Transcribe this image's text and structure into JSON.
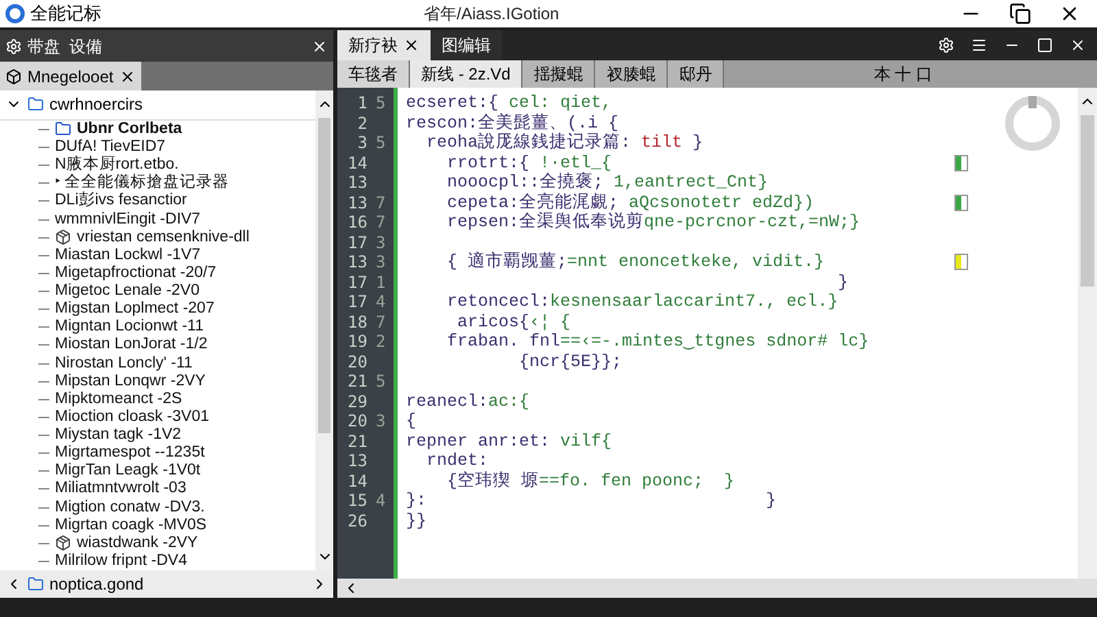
{
  "window": {
    "app_title": "全能记标",
    "title": "省年/Aiass.IGotion"
  },
  "left_panel": {
    "header": "带盘  设備",
    "tab": "Mnegelooet",
    "tree": {
      "label": "cwrhnoercirs",
      "expanded": true,
      "children": [
        {
          "label": "Ubnr Corlbeta",
          "kind": "folder"
        },
        {
          "label": "DUfA! TievEID7",
          "kind": "item"
        },
        {
          "label": "N腋本厨rort.etbo.",
          "kind": "item"
        },
        {
          "label": "‣ 全全能儀标搶盘记录器",
          "kind": "item"
        },
        {
          "label": "DLi彭ivs fesanctior",
          "kind": "item"
        },
        {
          "label": "wmmnivlEingit -DIV7",
          "kind": "item"
        },
        {
          "label": "vriestan cemsenknive-dll",
          "kind": "package"
        },
        {
          "label": "Miastan Lockwl -1V7",
          "kind": "item"
        },
        {
          "label": "Migetapfroctionat -20/7",
          "kind": "item"
        },
        {
          "label": "Migetoc Lenale -2V0",
          "kind": "item"
        },
        {
          "label": "Migstan Loplmect -207",
          "kind": "item"
        },
        {
          "label": "Migntan Locionwt -11",
          "kind": "item"
        },
        {
          "label": "Miostan LonJorat -1/2",
          "kind": "item"
        },
        {
          "label": "Nirostan Loncly' -11",
          "kind": "item"
        },
        {
          "label": "Mipstan Lonqwr -2VY",
          "kind": "item"
        },
        {
          "label": "Mipktomeanct -2S",
          "kind": "item"
        },
        {
          "label": "Mioction cloask -3V01",
          "kind": "item"
        },
        {
          "label": "Miystan tagk -1V2",
          "kind": "item"
        },
        {
          "label": "Migrtamespot --1235t",
          "kind": "item"
        },
        {
          "label": "MigrTan Leagk -1V0t",
          "kind": "item"
        },
        {
          "label": "Miliatmntvwrolt -03",
          "kind": "item"
        },
        {
          "label": "Migtion conatw -DV3.",
          "kind": "item"
        },
        {
          "label": "Migrtan coagk -MV0S",
          "kind": "item"
        },
        {
          "label": "wiastdwank -2VY",
          "kind": "package"
        },
        {
          "label": "Milrilow fripnt -DV4",
          "kind": "item"
        }
      ]
    },
    "footer": "noptica.gond"
  },
  "editor": {
    "tabs": [
      {
        "label": "新疗袂",
        "selected": true
      },
      {
        "label": "图编辑",
        "selected": false
      }
    ],
    "subtabs": [
      {
        "label": "车毯者",
        "selected": false
      },
      {
        "label": "新线 - 2z.Vd",
        "selected": true
      },
      {
        "label": "揺擬蜫",
        "selected": false
      },
      {
        "label": "衩腠蜫",
        "selected": false
      },
      {
        "label": "邸丹",
        "selected": false
      }
    ],
    "toolbar_text": "本 十 口",
    "lines": [
      {
        "num": "1",
        "num2": "5",
        "parts": [
          {
            "kind": "key",
            "text": "ecseret:{ "
          },
          {
            "kind": "value",
            "text": "cel: qiet,"
          }
        ]
      },
      {
        "num": "2",
        "parts": [
          {
            "kind": "key",
            "text": "rescon:全美髭薑、(.i {"
          }
        ]
      },
      {
        "num": "3",
        "num2": "5",
        "parts": [
          {
            "kind": "key",
            "text": "  reoha說厐線銭捷记录篇:"
          },
          {
            "kind": "string",
            "text": " tilt"
          },
          {
            "kind": "key",
            "text": " }"
          }
        ]
      },
      {
        "num": "14",
        "color": "#3aa845",
        "parts": [
          {
            "kind": "key",
            "text": "    rrotrt:{ "
          },
          {
            "kind": "value",
            "text": "!·etl_{"
          }
        ]
      },
      {
        "num": "13",
        "parts": [
          {
            "kind": "key",
            "text": "    nooocpl::全撓褒; "
          },
          {
            "kind": "value",
            "text": "1,eantrect_Cnt}"
          }
        ]
      },
      {
        "num": "13",
        "num2": "7",
        "color": "#3aa845",
        "parts": [
          {
            "kind": "key",
            "text": "    cepeta:全亮能浘覷; "
          },
          {
            "kind": "value",
            "text": "aQcsonotetr edZd})"
          }
        ]
      },
      {
        "num": "16",
        "num2": "7",
        "parts": [
          {
            "kind": "key",
            "text": "    repsen:全渠舆低奉说剪"
          },
          {
            "kind": "value",
            "text": "qne-pcrcnor-czt,=nW;}"
          }
        ]
      },
      {
        "num": "17",
        "num2": "3"
      },
      {
        "num": "13",
        "num2": "3",
        "color": "#e8e81a",
        "parts": [
          {
            "kind": "key",
            "text": "    { 適市覇觊薑;"
          },
          {
            "kind": "value",
            "text": "=nnt enoncetkeke, vidit.}"
          }
        ]
      },
      {
        "num": "17",
        "num2": "1",
        "parts": [
          {
            "kind": "key",
            "text": "                                          }"
          }
        ]
      },
      {
        "num": "17",
        "num2": "4",
        "parts": [
          {
            "kind": "key",
            "text": "    retoncecl:"
          },
          {
            "kind": "value",
            "text": "kesnensaarlaccarint7., ecl.}"
          }
        ]
      },
      {
        "num": "18",
        "num2": "7",
        "parts": [
          {
            "kind": "key",
            "text": "     aricos{"
          },
          {
            "kind": "value",
            "text": "‹¦ {"
          }
        ]
      },
      {
        "num": "19",
        "num2": "2",
        "parts": [
          {
            "kind": "key",
            "text": "    fraban. fnl"
          },
          {
            "kind": "value",
            "text": "==‹=-.mintes‿ttgnes sdnor# lc}"
          }
        ]
      },
      {
        "num": "20",
        "parts": [
          {
            "kind": "key",
            "text": "           {ncr{5E}};"
          }
        ]
      },
      {
        "num": "21",
        "num2": "5"
      },
      {
        "num": "29",
        "parts": [
          {
            "kind": "key",
            "text": "reanecl:"
          },
          {
            "kind": "value",
            "text": "ac:{"
          }
        ]
      },
      {
        "num": "20",
        "num2": "3",
        "parts": [
          {
            "kind": "key",
            "text": "{"
          }
        ]
      },
      {
        "num": "21",
        "parts": [
          {
            "kind": "key",
            "text": "repner anr:et: "
          },
          {
            "kind": "value",
            "text": "vilf{"
          }
        ]
      },
      {
        "num": "13",
        "parts": [
          {
            "kind": "key",
            "text": "  rndet:"
          }
        ]
      },
      {
        "num": "14",
        "parts": [
          {
            "kind": "key",
            "text": "    {空玮猰 塬"
          },
          {
            "kind": "value",
            "text": "==fo. fen poonc;  }"
          }
        ]
      },
      {
        "num": "15",
        "num2": "4",
        "parts": [
          {
            "kind": "key",
            "text": "}:                                 }"
          }
        ]
      },
      {
        "num": "26",
        "parts": [
          {
            "kind": "key",
            "text": "}}"
          }
        ]
      }
    ]
  }
}
